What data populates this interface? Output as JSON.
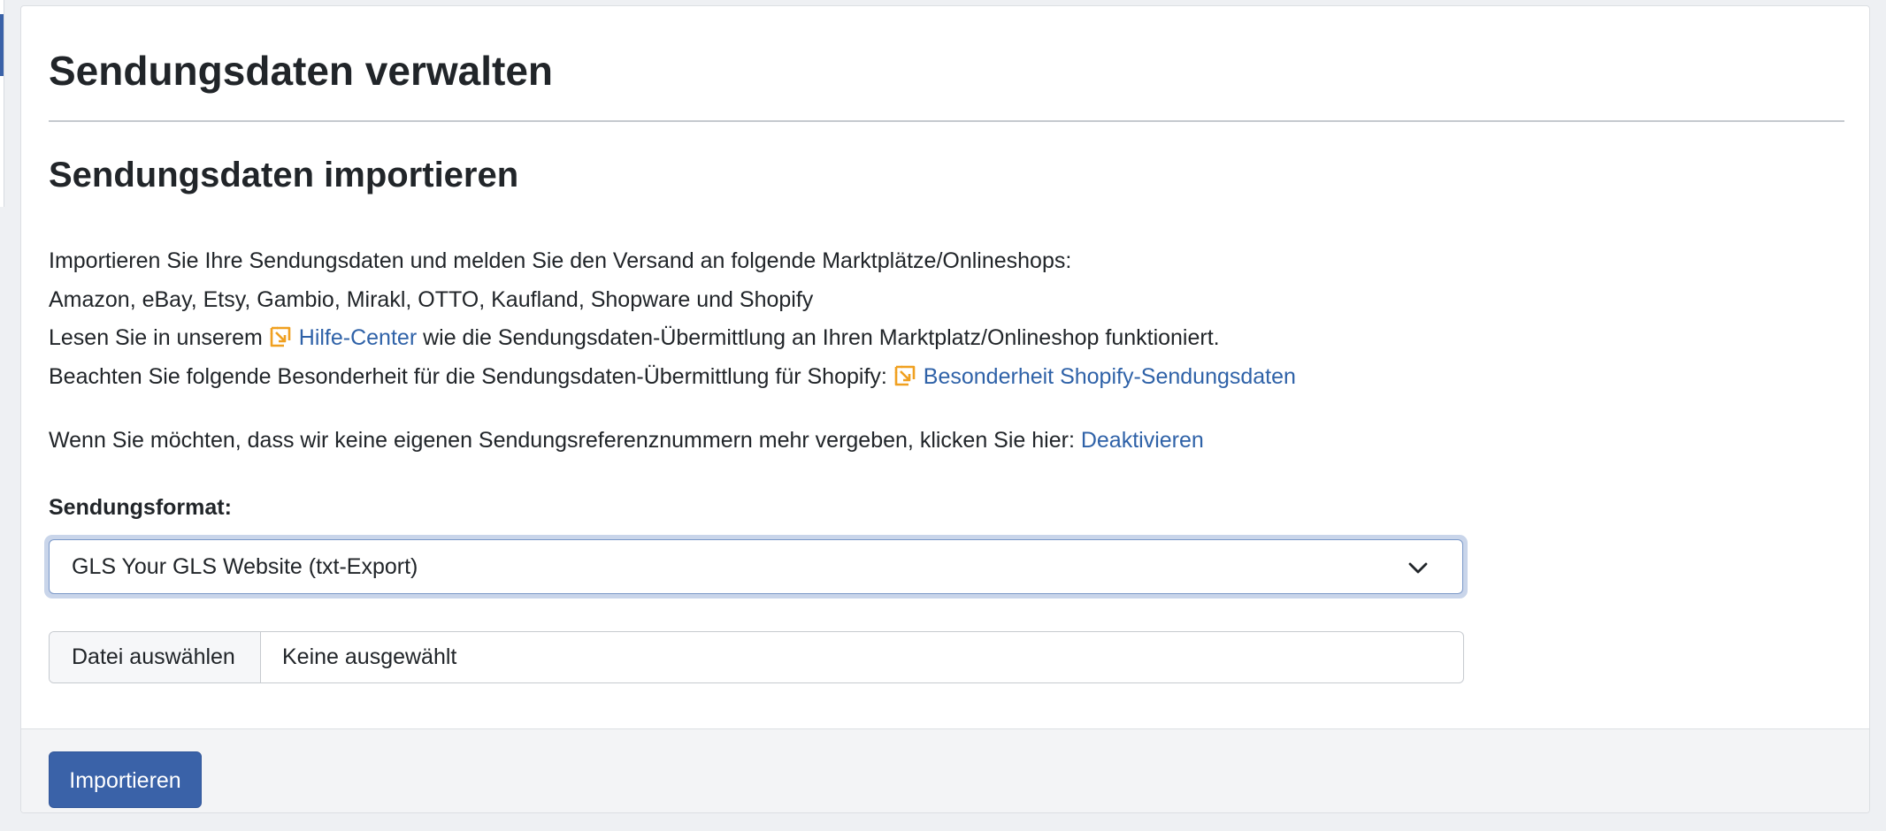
{
  "page": {
    "title": "Sendungsdaten verwalten"
  },
  "section": {
    "title": "Sendungsdaten importieren",
    "intro_line1": "Importieren Sie Ihre Sendungsdaten und melden Sie den Versand an folgende Marktplätze/Onlineshops:",
    "intro_line2": "Amazon, eBay, Etsy, Gambio, Mirakl, OTTO, Kaufland, Shopware und Shopify",
    "help_prefix": "Lesen Sie in unserem ",
    "help_link": "Hilfe-Center",
    "help_suffix": " wie die Sendungsdaten-Übermittlung an Ihren Marktplatz/Onlineshop funktioniert.",
    "shopify_prefix": "Beachten Sie folgende Besonderheit für die Sendungsdaten-Übermittlung für Shopify: ",
    "shopify_link": "Besonderheit Shopify-Sendungsdaten",
    "deactivate_prefix": "Wenn Sie möchten, dass wir keine eigenen Sendungsreferenznummern mehr vergeben, klicken Sie hier: ",
    "deactivate_link": "Deaktivieren"
  },
  "form": {
    "format_label": "Sendungsformat:",
    "format_selected": "GLS Your GLS Website (txt-Export)",
    "file_button": "Datei auswählen",
    "file_status": "Keine ausgewählt"
  },
  "footer": {
    "import_button": "Importieren"
  },
  "icons": {
    "external_link": "external-link-icon",
    "dropdown": "chevron-down-icon"
  },
  "colors": {
    "link": "#2f62a8",
    "primary_button": "#3a62a8",
    "external_icon": "#f0a020"
  }
}
